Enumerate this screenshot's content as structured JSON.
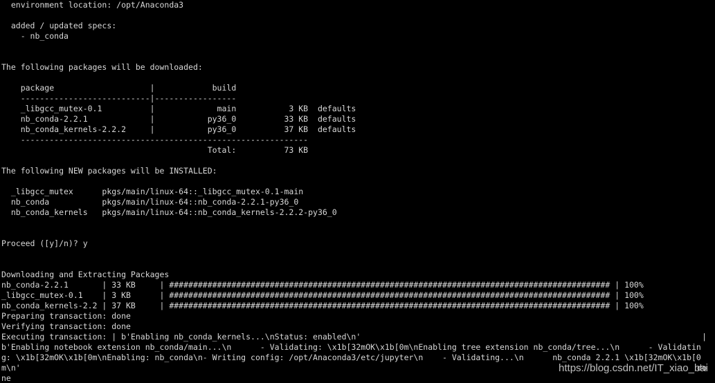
{
  "terminal": {
    "lines": [
      "  environment location: /opt/Anaconda3",
      "",
      "  added / updated specs:",
      "    - nb_conda",
      "",
      "",
      "The following packages will be downloaded:",
      "",
      "    package                    |            build",
      "    ---------------------------|-----------------",
      "    _libgcc_mutex-0.1          |             main           3 KB  defaults",
      "    nb_conda-2.2.1             |           py36_0          33 KB  defaults",
      "    nb_conda_kernels-2.2.2     |           py36_0          37 KB  defaults",
      "    ------------------------------------------------------------",
      "                                           Total:          73 KB",
      "",
      "The following NEW packages will be INSTALLED:",
      "",
      "  _libgcc_mutex      pkgs/main/linux-64::_libgcc_mutex-0.1-main",
      "  nb_conda           pkgs/main/linux-64::nb_conda-2.2.1-py36_0",
      "  nb_conda_kernels   pkgs/main/linux-64::nb_conda_kernels-2.2.2-py36_0",
      "",
      "",
      "Proceed ([y]/n)? y",
      "",
      "",
      "Downloading and Extracting Packages",
      "nb_conda-2.2.1       | 33 KB     | ############################################################################################ | 100%",
      "_libgcc_mutex-0.1    | 3 KB      | ############################################################################################ | 100%",
      "nb_conda_kernels-2.2 | 37 KB     | ############################################################################################ | 100%",
      "Preparing transaction: done",
      "Verifying transaction: done",
      "Executing transaction: | b'Enabling nb_conda_kernels...\\nStatus: enabled\\n'",
      "b'Enabling notebook extension nb_conda/main...\\n      - Validating: \\x1b[32mOK\\x1b[0m\\nEnabling tree extension nb_conda/tree...\\n      - Validatin",
      "g: \\x1b[32mOK\\x1b[0m\\nEnabling: nb_conda\\n- Writing config: /opt/Anaconda3/etc/jupyter\\n    - Validating...\\n      nb_conda 2.2.1 \\x1b[32mOK\\x1b[0",
      "m\\n'",
      "ne"
    ],
    "spinner_char": "|",
    "trailing_fragment": "do",
    "watermark": "https://blog.csdn.net/IT_xiao_bai"
  },
  "colors": {
    "background": "#000000",
    "foreground": "#d8d8d8"
  }
}
